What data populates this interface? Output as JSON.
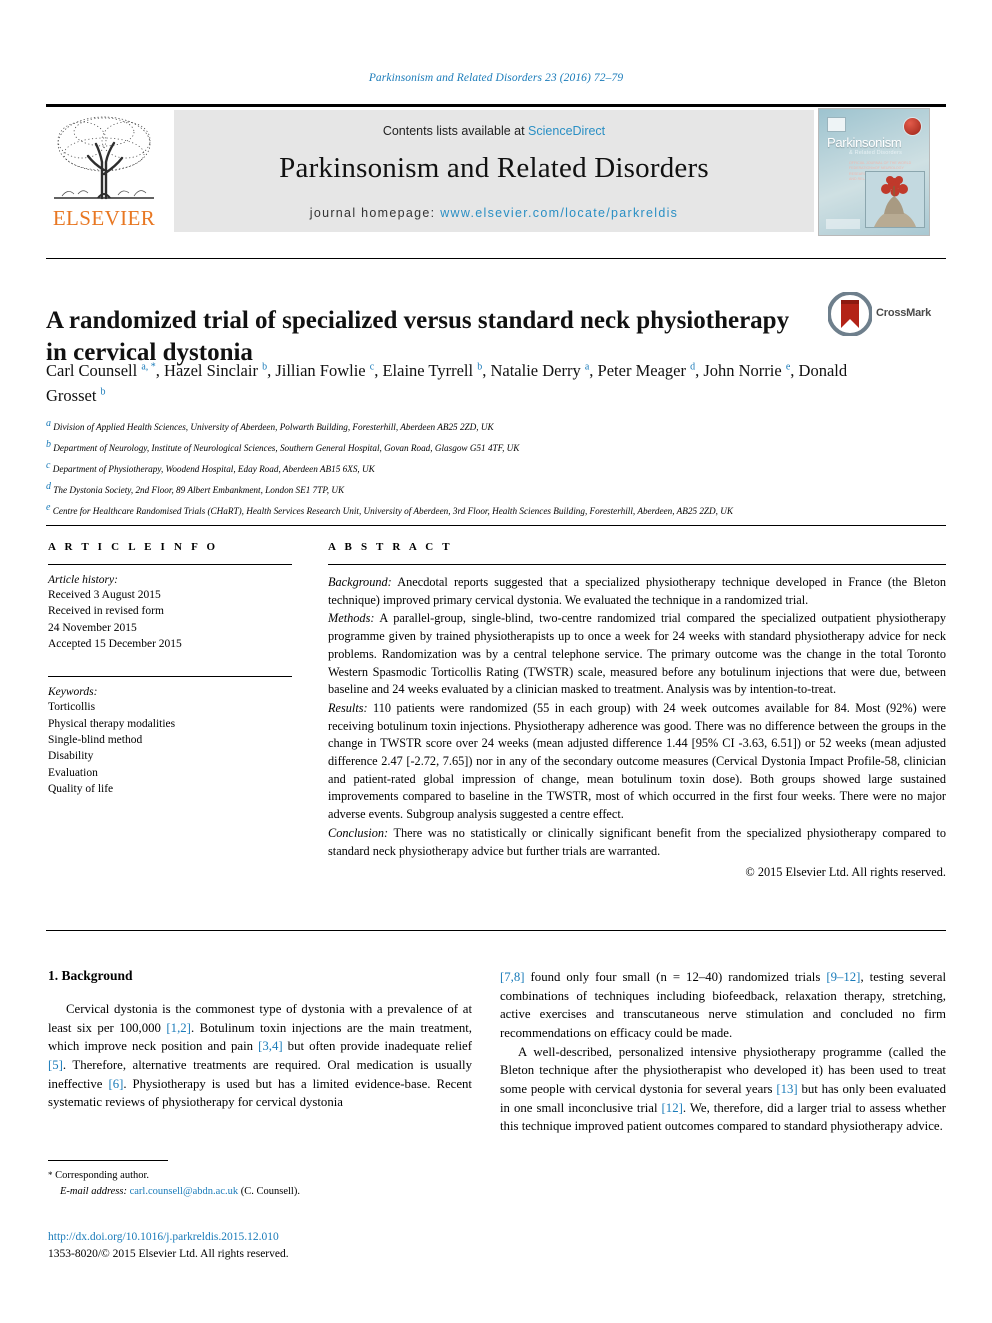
{
  "running_head": "Parkinsonism and Related Disorders 23 (2016) 72–79",
  "masthead": {
    "contents_prefix": "Contents lists available at ",
    "sciencedirect": "ScienceDirect",
    "journal_title": "Parkinsonism and Related Disorders",
    "homepage_prefix": "journal homepage: ",
    "homepage_url": "www.elsevier.com/locate/parkreldis",
    "publisher": "ELSEVIER",
    "publisher_logo_icon": "elsevier-tree-logo",
    "cover": {
      "title": "Parkinsonism",
      "subtitle": "& Related Disorders",
      "tagline": "OFFICIAL JOURNAL OF THE WORLD FEDERATION\\nOF NEUROLOGY RESEARCH GROUP ON\\nPARKINSONISM AND RELATED DISORDERS"
    }
  },
  "article": {
    "title": "A randomized trial of specialized versus standard neck physiotherapy in cervical dystonia",
    "crossmark_label": "CrossMark",
    "crossmark_icon": "crossmark-badge-icon",
    "authors": [
      {
        "name": "Carl Counsell",
        "sup": "a, *"
      },
      {
        "name": "Hazel Sinclair",
        "sup": "b"
      },
      {
        "name": "Jillian Fowlie",
        "sup": "c"
      },
      {
        "name": "Elaine Tyrrell",
        "sup": "b"
      },
      {
        "name": "Natalie Derry",
        "sup": "a"
      },
      {
        "name": "Peter Meager",
        "sup": "d"
      },
      {
        "name": "John Norrie",
        "sup": "e"
      },
      {
        "name": "Donald Grosset",
        "sup": "b"
      }
    ],
    "affiliations": [
      {
        "marker": "a",
        "text": "Division of Applied Health Sciences, University of Aberdeen, Polwarth Building, Foresterhill, Aberdeen AB25 2ZD, UK"
      },
      {
        "marker": "b",
        "text": "Department of Neurology, Institute of Neurological Sciences, Southern General Hospital, Govan Road, Glasgow G51 4TF, UK"
      },
      {
        "marker": "c",
        "text": "Department of Physiotherapy, Woodend Hospital, Eday Road, Aberdeen AB15 6XS, UK"
      },
      {
        "marker": "d",
        "text": "The Dystonia Society, 2nd Floor, 89 Albert Embankment, London SE1 7TP, UK"
      },
      {
        "marker": "e",
        "text": "Centre for Healthcare Randomised Trials (CHaRT), Health Services Research Unit, University of Aberdeen, 3rd Floor, Health Sciences Building, Foresterhill, Aberdeen, AB25 2ZD, UK"
      }
    ]
  },
  "article_info": {
    "label": "A R T I C L E   I N F O",
    "history_heading": "Article history:",
    "history": [
      "Received 3 August 2015",
      "Received in revised form",
      "24 November 2015",
      "Accepted 15 December 2015"
    ],
    "keywords_heading": "Keywords:",
    "keywords": [
      "Torticollis",
      "Physical therapy modalities",
      "Single-blind method",
      "Disability",
      "Evaluation",
      "Quality of life"
    ]
  },
  "abstract": {
    "label": "A B S T R A C T",
    "sections": [
      {
        "heading": "Background:",
        "text": " Anecdotal reports suggested that a specialized physiotherapy technique developed in France (the Bleton technique) improved primary cervical dystonia. We evaluated the technique in a randomized trial."
      },
      {
        "heading": "Methods:",
        "text": " A parallel-group, single-blind, two-centre randomized trial compared the specialized outpatient physiotherapy programme given by trained physiotherapists up to once a week for 24 weeks with standard physiotherapy advice for neck problems. Randomization was by a central telephone service. The primary outcome was the change in the total Toronto Western Spasmodic Torticollis Rating (TWSTR) scale, measured before any botulinum injections that were due, between baseline and 24 weeks evaluated by a clinician masked to treatment. Analysis was by intention-to-treat."
      },
      {
        "heading": "Results:",
        "text": " 110 patients were randomized (55 in each group) with 24 week outcomes available for 84. Most (92%) were receiving botulinum toxin injections. Physiotherapy adherence was good. There was no difference between the groups in the change in TWSTR score over 24 weeks (mean adjusted difference 1.44 [95% CI -3.63, 6.51]) or 52 weeks (mean adjusted difference 2.47 [-2.72, 7.65]) nor in any of the secondary outcome measures (Cervical Dystonia Impact Profile-58, clinician and patient-rated global impression of change, mean botulinum toxin dose). Both groups showed large sustained improvements compared to baseline in the TWSTR, most of which occurred in the first four weeks. There were no major adverse events. Subgroup analysis suggested a centre effect."
      },
      {
        "heading": "Conclusion:",
        "text": " There was no statistically or clinically significant benefit from the specialized physiotherapy compared to standard neck physiotherapy advice but further trials are warranted."
      }
    ],
    "copyright": "© 2015 Elsevier Ltd. All rights reserved."
  },
  "body": {
    "section_heading": "1. Background",
    "left_paragraph_parts": [
      {
        "t": "Cervical dystonia is the commonest type of dystonia with a prevalence of at least six per 100,000 "
      },
      {
        "t": "[1,2]",
        "ref": true
      },
      {
        "t": ". Botulinum toxin injections are the main treatment, which improve neck position and pain "
      },
      {
        "t": "[3,4]",
        "ref": true
      },
      {
        "t": " but often provide inadequate relief "
      },
      {
        "t": "[5]",
        "ref": true
      },
      {
        "t": ". Therefore, alternative treatments are required. Oral medication is usually ineffective "
      },
      {
        "t": "[6]",
        "ref": true
      },
      {
        "t": ". Physiotherapy is used but has a limited evidence-base. Recent systematic reviews of physiotherapy for cervical dystonia "
      }
    ],
    "right_paragraph1_parts": [
      {
        "t": "[7,8]",
        "ref": true
      },
      {
        "t": " found only four small (n = 12–40) randomized trials "
      },
      {
        "t": "[9–12]",
        "ref": true
      },
      {
        "t": ", testing several combinations of techniques including biofeedback, relaxation therapy, stretching, active exercises and transcutaneous nerve stimulation and concluded no firm recommendations on efficacy could be made."
      }
    ],
    "right_paragraph2_parts": [
      {
        "t": "A well-described, personalized intensive physiotherapy programme (called the Bleton technique after the physiotherapist who developed it) has been used to treat some people with cervical dystonia for several years "
      },
      {
        "t": "[13]",
        "ref": true
      },
      {
        "t": " but has only been evaluated in one small inconclusive trial "
      },
      {
        "t": "[12]",
        "ref": true
      },
      {
        "t": ". We, therefore, did a larger trial to assess whether this technique improved patient outcomes compared to standard physiotherapy advice."
      }
    ]
  },
  "footer": {
    "corresponding_marker": "*",
    "corresponding_label": " Corresponding author.",
    "email_label": "E-mail address:",
    "email": "carl.counsell@abdn.ac.uk",
    "email_suffix": " (C. Counsell).",
    "doi": "http://dx.doi.org/10.1016/j.parkreldis.2015.12.010",
    "issn_line": "1353-8020/© 2015 Elsevier Ltd. All rights reserved."
  },
  "colors": {
    "link_blue": "#1a7bb9",
    "sciencedirect_blue": "#2a8fc4",
    "elsevier_orange": "#e87722",
    "banner_gray": "#e6e6e6"
  }
}
